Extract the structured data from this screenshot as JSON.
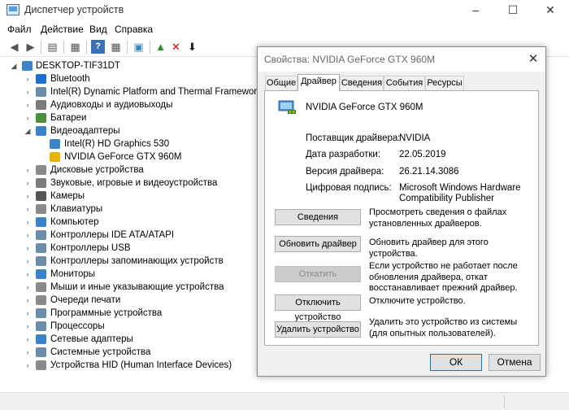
{
  "window": {
    "title": "Диспетчер устройств",
    "minimize": "–",
    "maximize": "☐",
    "close": "✕"
  },
  "menu": [
    "Файл",
    "Действие",
    "Вид",
    "Справка"
  ],
  "tree": {
    "root": "DESKTOP-TIF31DT",
    "items": [
      {
        "label": "Bluetooth",
        "color": "#1f6fd1"
      },
      {
        "label": "Intel(R) Dynamic Platform and Thermal Framework",
        "color": "#6a8caf"
      },
      {
        "label": "Аудиовходы и аудиовыходы",
        "color": "#7a7a7a"
      },
      {
        "label": "Батареи",
        "color": "#4e8f3a"
      },
      {
        "label": "Видеоадаптеры",
        "color": "#3b84c8"
      },
      {
        "label": "Intel(R) HD Graphics 530",
        "color": "#3b84c8"
      },
      {
        "label": "NVIDIA GeForce GTX 960M",
        "color": "#e8b400"
      },
      {
        "label": "Дисковые устройства",
        "color": "#8a8a8a"
      },
      {
        "label": "Звуковые, игровые и видеоустройства",
        "color": "#7a7a7a"
      },
      {
        "label": "Камеры",
        "color": "#555555"
      },
      {
        "label": "Клавиатуры",
        "color": "#8a8a8a"
      },
      {
        "label": "Компьютер",
        "color": "#3b84c8"
      },
      {
        "label": "Контроллеры IDE ATA/ATAPI",
        "color": "#6a8caf"
      },
      {
        "label": "Контроллеры USB",
        "color": "#6a8caf"
      },
      {
        "label": "Контроллеры запоминающих устройств",
        "color": "#6a8caf"
      },
      {
        "label": "Мониторы",
        "color": "#3b84c8"
      },
      {
        "label": "Мыши и иные указывающие устройства",
        "color": "#8a8a8a"
      },
      {
        "label": "Очереди печати",
        "color": "#8a8a8a"
      },
      {
        "label": "Программные устройства",
        "color": "#6a8caf"
      },
      {
        "label": "Процессоры",
        "color": "#6a8caf"
      },
      {
        "label": "Сетевые адаптеры",
        "color": "#3b84c8"
      },
      {
        "label": "Системные устройства",
        "color": "#6a8caf"
      },
      {
        "label": "Устройства HID (Human Interface Devices)",
        "color": "#8a8a8a"
      }
    ]
  },
  "dialog": {
    "title": "Свойства: NVIDIA GeForce GTX 960M",
    "close": "✕",
    "tabs": [
      "Общие",
      "Драйвер",
      "Сведения",
      "События",
      "Ресурсы"
    ],
    "active_tab": "Драйвер",
    "device_name": "NVIDIA GeForce GTX 960M",
    "props": [
      {
        "key": "Поставщик драйвера:",
        "value": "NVIDIA"
      },
      {
        "key": "Дата разработки:",
        "value": "22.05.2019"
      },
      {
        "key": "Версия драйвера:",
        "value": "26.21.14.3086"
      },
      {
        "key": "Цифровая подпись:",
        "value": "Microsoft Windows Hardware Compatibility Publisher"
      }
    ],
    "actions": [
      {
        "label": "Сведения",
        "desc": "Просмотреть сведения о файлах установленных драйверов.",
        "enabled": true
      },
      {
        "label": "Обновить драйвер",
        "desc": "Обновить драйвер для этого устройства.",
        "enabled": true
      },
      {
        "label": "Откатить",
        "desc": "Если устройство не работает после обновления драйвера, откат восстанавливает прежний драйвер.",
        "enabled": false
      },
      {
        "label": "Отключить устройство",
        "desc": "Отключите устройство.",
        "enabled": true
      },
      {
        "label": "Удалить устройство",
        "desc": "Удалить это устройство из системы (для опытных пользователей).",
        "enabled": true
      }
    ],
    "ok": "ОК",
    "cancel": "Отмена"
  }
}
